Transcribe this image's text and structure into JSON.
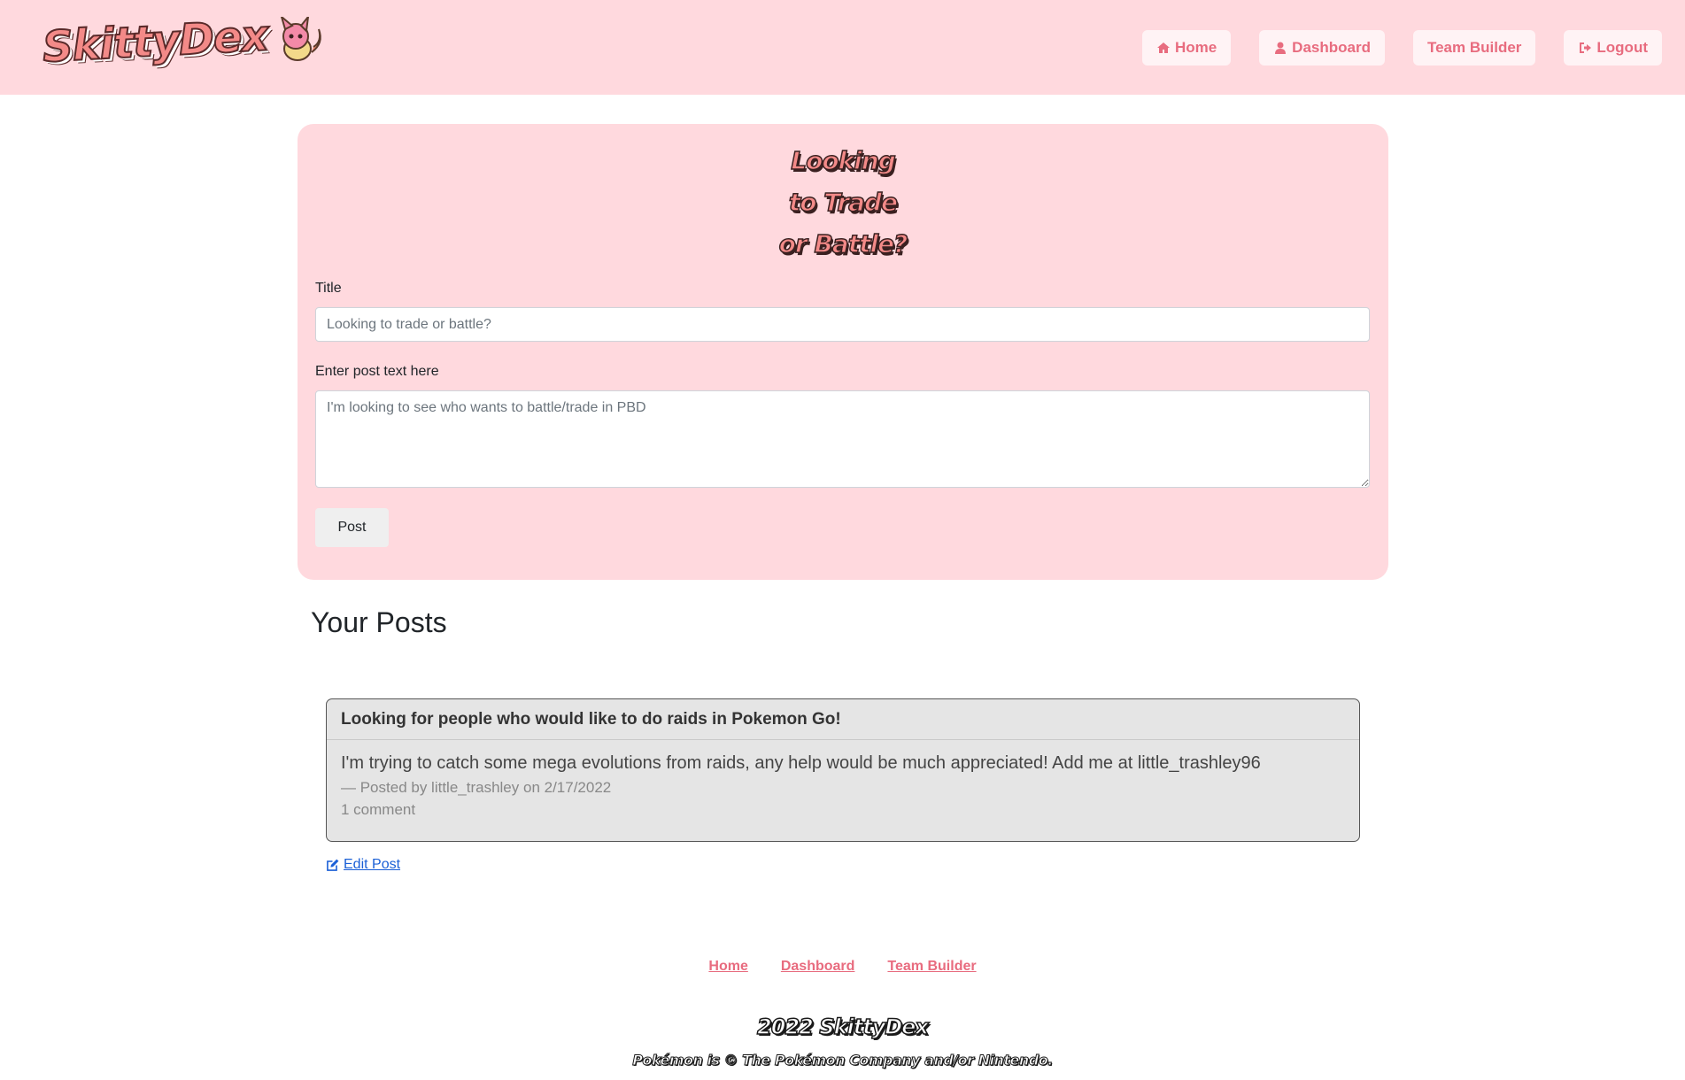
{
  "header": {
    "logo_text": "SkittyDex",
    "nav": [
      {
        "label": "Home",
        "icon": "home-icon"
      },
      {
        "label": "Dashboard",
        "icon": "user-icon"
      },
      {
        "label": "Team Builder",
        "icon": ""
      },
      {
        "label": "Logout",
        "icon": "logout-icon"
      }
    ]
  },
  "form": {
    "heading": "Looking to Trade or Battle?",
    "title_label": "Title",
    "title_placeholder": "Looking to trade or battle?",
    "text_label": "Enter post text here",
    "text_placeholder": "I'm looking to see who wants to battle/trade in PBD",
    "post_button": "Post"
  },
  "posts": {
    "heading": "Your Posts",
    "items": [
      {
        "title": "Looking for people who would like to do raids in Pokemon Go!",
        "body": "I'm trying to catch some mega evolutions from raids, any help would be much appreciated! Add me at little_trashley96",
        "meta": "—  Posted by little_trashley on 2/17/2022",
        "comments": "1 comment",
        "edit_label": "Edit Post"
      }
    ]
  },
  "footer": {
    "links": [
      "Home",
      "Dashboard",
      "Team Builder"
    ],
    "copyright": "2022 SkittyDex",
    "disclaimer": "Pokémon is © The Pokémon Company and/or Nintendo."
  },
  "colors": {
    "header_bg": "#ffd9de",
    "accent": "#e86c7f",
    "link": "#1a5fd6"
  }
}
